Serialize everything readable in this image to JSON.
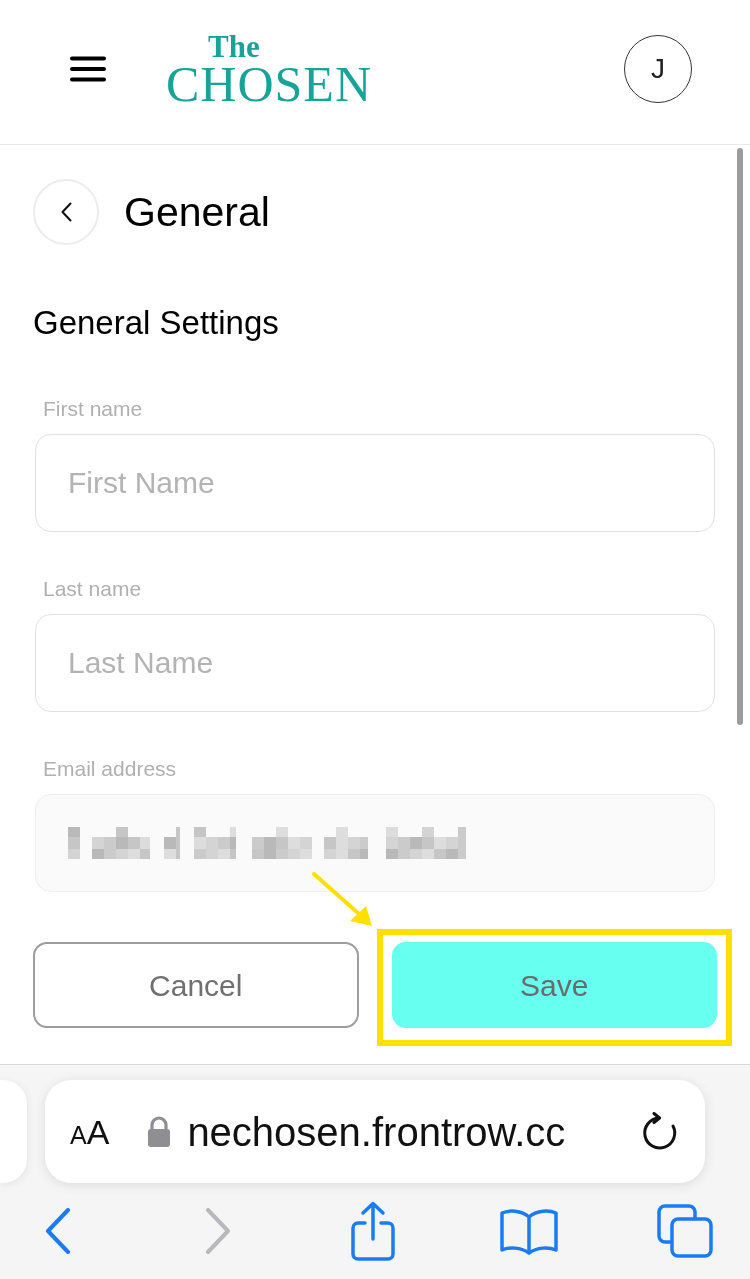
{
  "header": {
    "logo": {
      "line_1": "The",
      "line_2": "CHOSEN"
    },
    "avatar_initial": "J"
  },
  "page": {
    "title": "General",
    "section_title": "General Settings"
  },
  "fields": [
    {
      "label": "First name",
      "placeholder": "First Name",
      "disabled": false
    },
    {
      "label": "Last name",
      "placeholder": "Last Name",
      "disabled": false
    },
    {
      "label": "Email address",
      "disabled": true,
      "value_redacted": true
    }
  ],
  "buttons": [
    {
      "label": "Cancel",
      "kind": "secondary",
      "highlighted": false
    },
    {
      "label": "Save",
      "kind": "primary",
      "highlighted": true
    }
  ],
  "browser": {
    "text_size_button": "AA",
    "url": "nechosen.frontrow.cc",
    "secure": true,
    "toolbar": [
      {
        "kind": "back",
        "disabled": false
      },
      {
        "kind": "forward",
        "disabled": true
      },
      {
        "kind": "share",
        "disabled": false
      },
      {
        "kind": "bookmarks",
        "disabled": false
      },
      {
        "kind": "tabs",
        "disabled": false
      }
    ]
  }
}
